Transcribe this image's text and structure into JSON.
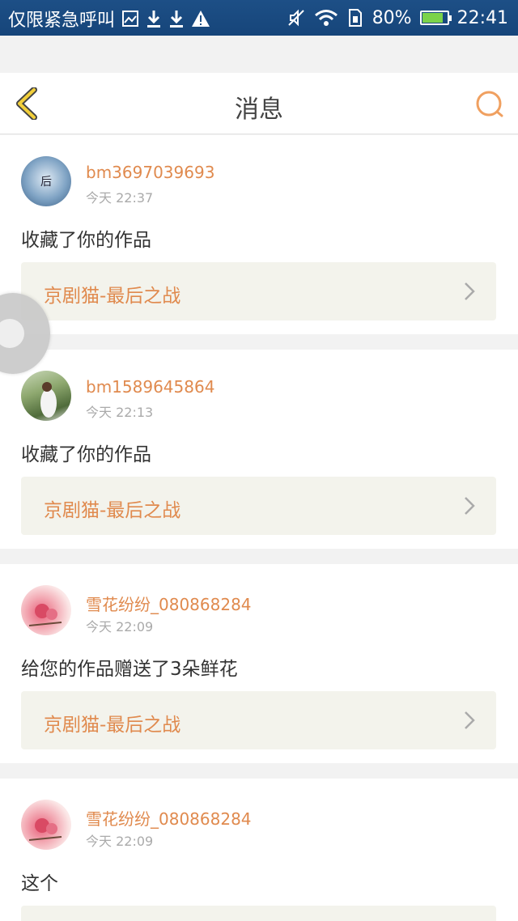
{
  "status_bar": {
    "carrier": "仅限紧急呼叫",
    "battery": "80%",
    "time": "22:41",
    "icons": [
      "image-icon",
      "download-icon",
      "download-icon",
      "warning-icon",
      "mute-icon",
      "wifi-icon",
      "sim-icon",
      "battery-icon"
    ]
  },
  "header": {
    "title": "消息",
    "back_icon": "chevron-left-icon",
    "search_icon": "search-icon"
  },
  "messages": [
    {
      "username": "bm3697039693",
      "time": "今天 22:37",
      "text": "收藏了你的作品",
      "work_title": "京剧猫-最后之战"
    },
    {
      "username": "bm1589645864",
      "time": "今天 22:13",
      "text": "收藏了你的作品",
      "work_title": "京剧猫-最后之战"
    },
    {
      "username": "雪花纷纷_080868284",
      "time": "今天 22:09",
      "text": "给您的作品赠送了3朵鲜花",
      "work_title": "京剧猫-最后之战"
    },
    {
      "username": "雪花纷纷_080868284",
      "time": "今天 22:09",
      "text": "这个",
      "work_title": ""
    }
  ],
  "colors": {
    "accent": "#e08a4e",
    "status_bar": "#1d4f86",
    "work_bg": "#f3f3ec",
    "back_icon": "#e3b321"
  }
}
